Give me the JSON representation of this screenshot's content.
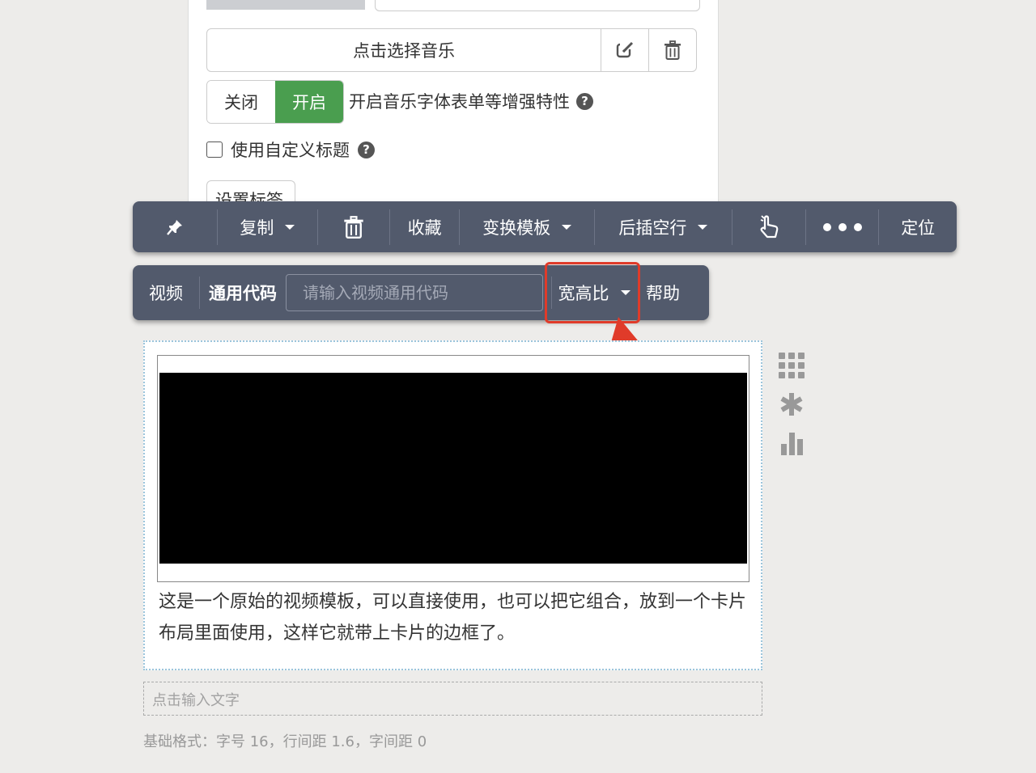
{
  "panel": {
    "music_button": "点击选择音乐",
    "toggle_off": "关闭",
    "toggle_on": "开启",
    "enhance_label": "开启音乐字体表单等增强特性",
    "custom_title_label": "使用自定义标题",
    "set_tag_button": "设置标签"
  },
  "toolbar": {
    "copy": "复制",
    "favorite": "收藏",
    "switch_template": "变换模板",
    "insert_blank_after": "后插空行",
    "locate": "定位"
  },
  "video_toolbar": {
    "video": "视频",
    "general_code": "通用代码",
    "code_placeholder": "请输入视频通用代码",
    "aspect_ratio": "宽高比",
    "help": "帮助"
  },
  "card": {
    "description": "这是一个原始的视频模板，可以直接使用，也可以把它组合，放到一个卡片布局里面使用，这样它就带上卡片的边框了。"
  },
  "text_input_placeholder": "点击输入文字",
  "base_format": "基础格式：字号 16，行间距 1.6，字间距 0",
  "colors": {
    "toolbar_bg": "#525a6c",
    "toggle_on": "#4a9e4f",
    "highlight": "#e03b2a",
    "card_border": "#9cc5dc"
  }
}
